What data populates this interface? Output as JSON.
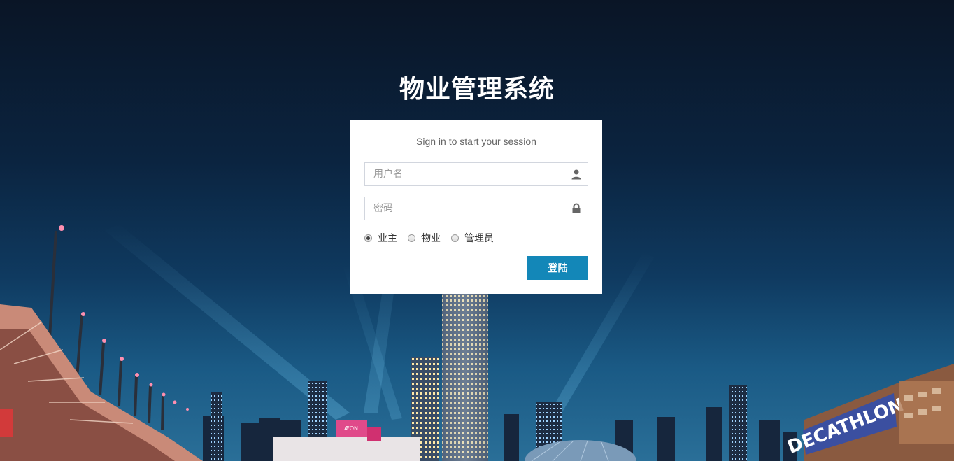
{
  "app": {
    "title": "物业管理系统"
  },
  "login": {
    "message": "Sign in to start your session",
    "username": {
      "placeholder": "用户名",
      "value": "",
      "icon": "user-icon"
    },
    "password": {
      "placeholder": "密码",
      "value": "",
      "icon": "lock-icon"
    },
    "roles": [
      {
        "label": "业主",
        "checked": true
      },
      {
        "label": "物业",
        "checked": false
      },
      {
        "label": "管理员",
        "checked": false
      }
    ],
    "submit_label": "登陆"
  },
  "background": {
    "signage": [
      "DECATHLON",
      "ÆON"
    ]
  },
  "colors": {
    "button": "#1387b8",
    "sky_top": "#0a1526",
    "sky_bottom": "#2a6f98"
  }
}
